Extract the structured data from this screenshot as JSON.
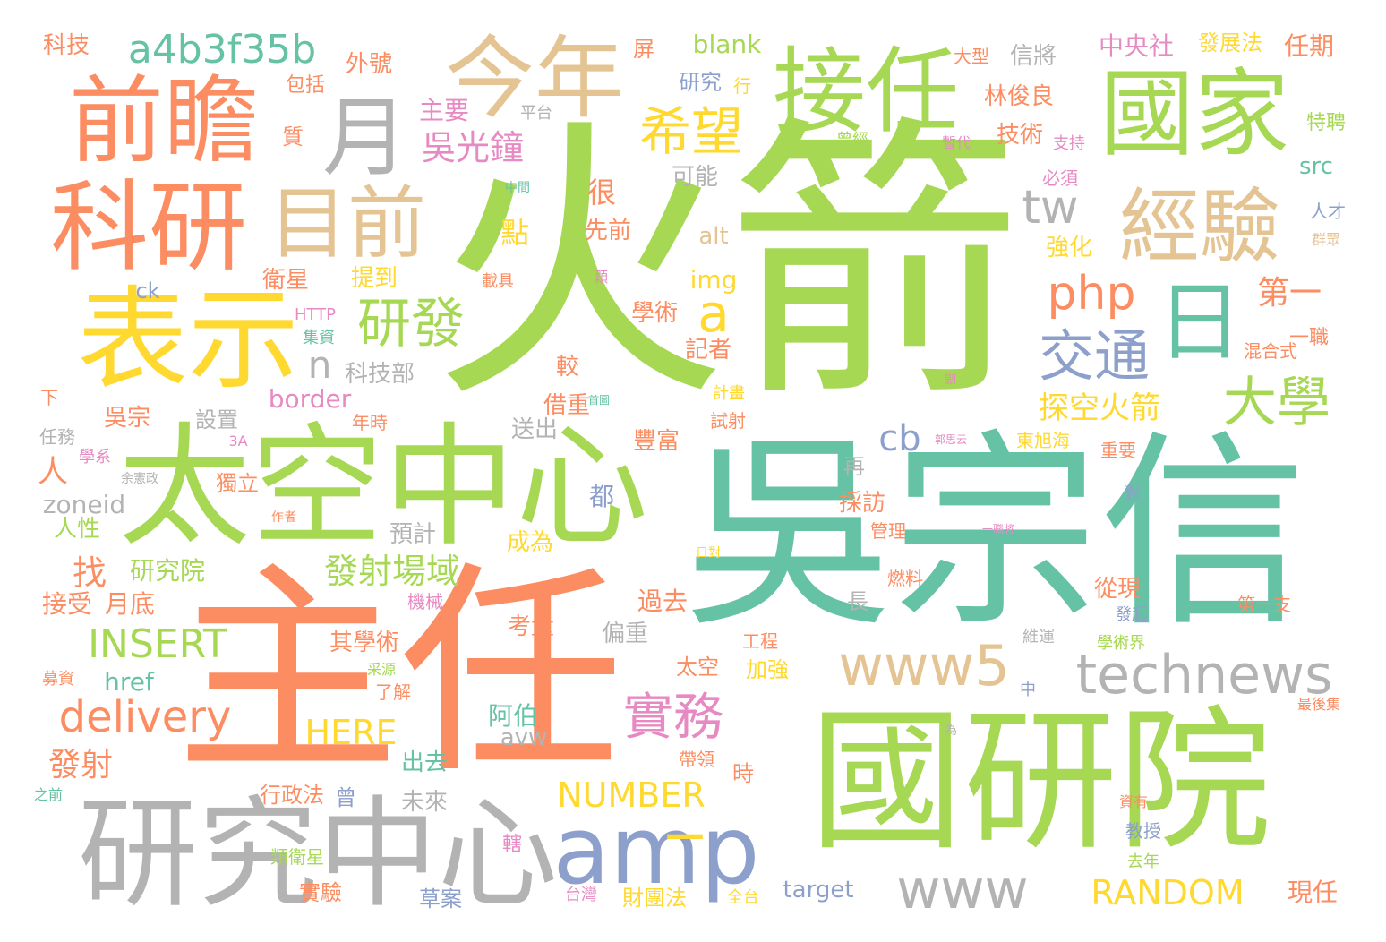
{
  "palette": {
    "green": "#a6d854",
    "teal": "#66c2a5",
    "orange": "#fc8d62",
    "tan": "#e5c494",
    "gray": "#b3b3b3",
    "blue": "#8da0cb",
    "pink": "#e78ac3",
    "yellow": "#ffd92f"
  },
  "words": [
    {
      "text": "火箭",
      "color": "green"
    },
    {
      "text": "吳宗信",
      "color": "teal"
    },
    {
      "text": "主任",
      "color": "orange"
    },
    {
      "text": "國研院",
      "color": "green"
    },
    {
      "text": "太空中心",
      "color": "green"
    },
    {
      "text": "研究中心",
      "color": "gray"
    },
    {
      "text": "前瞻",
      "color": "orange"
    },
    {
      "text": "科研",
      "color": "orange"
    },
    {
      "text": "表示",
      "color": "yellow"
    },
    {
      "text": "國家",
      "color": "green"
    },
    {
      "text": "接任",
      "color": "green"
    },
    {
      "text": "今年",
      "color": "tan"
    },
    {
      "text": "目前",
      "color": "tan"
    },
    {
      "text": "經驗",
      "color": "tan"
    },
    {
      "text": "月",
      "color": "gray"
    },
    {
      "text": "日",
      "color": "teal"
    },
    {
      "text": "amp",
      "color": "blue"
    },
    {
      "text": "technews",
      "color": "gray"
    },
    {
      "text": "www5",
      "color": "tan"
    },
    {
      "text": "www",
      "color": "gray"
    },
    {
      "text": "a4b3f35b",
      "color": "teal"
    },
    {
      "text": "希望",
      "color": "yellow"
    },
    {
      "text": "研發",
      "color": "green"
    },
    {
      "text": "交通",
      "color": "blue"
    },
    {
      "text": "大學",
      "color": "green"
    },
    {
      "text": "tw",
      "color": "gray"
    },
    {
      "text": "php",
      "color": "orange"
    },
    {
      "text": "a",
      "color": "yellow"
    },
    {
      "text": "n",
      "color": "gray"
    },
    {
      "text": "吳光鐘",
      "color": "pink"
    },
    {
      "text": "實務",
      "color": "pink"
    },
    {
      "text": "delivery",
      "color": "orange"
    },
    {
      "text": "INSERT",
      "color": "green"
    },
    {
      "text": "發射場域",
      "color": "green"
    },
    {
      "text": "探空火箭",
      "color": "yellow"
    },
    {
      "text": "cb",
      "color": "blue"
    },
    {
      "text": "RANDOM",
      "color": "yellow"
    },
    {
      "text": "NUMBER",
      "color": "yellow"
    },
    {
      "text": "HERE",
      "color": "yellow"
    },
    {
      "text": "_",
      "color": "yellow"
    },
    {
      "text": "第一",
      "color": "orange"
    },
    {
      "text": "找",
      "color": "orange"
    },
    {
      "text": "發射",
      "color": "orange"
    },
    {
      "text": "很",
      "color": "orange"
    },
    {
      "text": "點",
      "color": "yellow"
    },
    {
      "text": "人",
      "color": "orange"
    },
    {
      "text": "zoneid",
      "color": "gray"
    },
    {
      "text": "href",
      "color": "teal"
    },
    {
      "text": "border",
      "color": "pink"
    },
    {
      "text": "img",
      "color": "yellow"
    },
    {
      "text": "alt",
      "color": "tan"
    },
    {
      "text": "blank",
      "color": "green"
    },
    {
      "text": "src",
      "color": "teal"
    },
    {
      "text": "target",
      "color": "blue"
    },
    {
      "text": "avw",
      "color": "gray"
    },
    {
      "text": "ck",
      "color": "blue"
    },
    {
      "text": "HTTP",
      "color": "pink"
    },
    {
      "text": "科技",
      "color": "orange"
    },
    {
      "text": "外號",
      "color": "orange"
    },
    {
      "text": "包括",
      "color": "orange"
    },
    {
      "text": "質",
      "color": "orange"
    },
    {
      "text": "主要",
      "color": "pink"
    },
    {
      "text": "屏",
      "color": "orange"
    },
    {
      "text": "研究",
      "color": "blue"
    },
    {
      "text": "行",
      "color": "yellow"
    },
    {
      "text": "平台",
      "color": "gray"
    },
    {
      "text": "大型",
      "color": "orange"
    },
    {
      "text": "信將",
      "color": "gray"
    },
    {
      "text": "林俊良",
      "color": "orange"
    },
    {
      "text": "技術",
      "color": "orange"
    },
    {
      "text": "中央社",
      "color": "pink"
    },
    {
      "text": "發展法",
      "color": "yellow"
    },
    {
      "text": "任期",
      "color": "orange"
    },
    {
      "text": "特聘",
      "color": "green"
    },
    {
      "text": "曾經",
      "color": "green"
    },
    {
      "text": "暫代",
      "color": "pink"
    },
    {
      "text": "支持",
      "color": "pink"
    },
    {
      "text": "必須",
      "color": "pink"
    },
    {
      "text": "可能",
      "color": "gray"
    },
    {
      "text": "中間",
      "color": "teal"
    },
    {
      "text": "人才",
      "color": "blue"
    },
    {
      "text": "群眾",
      "color": "tan"
    },
    {
      "text": "強化",
      "color": "yellow"
    },
    {
      "text": "先前",
      "color": "orange"
    },
    {
      "text": "載具",
      "color": "orange"
    },
    {
      "text": "顆",
      "color": "pink"
    },
    {
      "text": "提到",
      "color": "yellow"
    },
    {
      "text": "衛星",
      "color": "orange"
    },
    {
      "text": "學術",
      "color": "orange"
    },
    {
      "text": "記者",
      "color": "orange"
    },
    {
      "text": "集資",
      "color": "teal"
    },
    {
      "text": "一職",
      "color": "orange"
    },
    {
      "text": "混合式",
      "color": "orange"
    },
    {
      "text": "科技部",
      "color": "gray"
    },
    {
      "text": "較",
      "color": "orange"
    },
    {
      "text": "副",
      "color": "pink"
    },
    {
      "text": "借重",
      "color": "orange"
    },
    {
      "text": "首圖",
      "color": "teal"
    },
    {
      "text": "計畫",
      "color": "yellow"
    },
    {
      "text": "吳宗",
      "color": "orange"
    },
    {
      "text": "設置",
      "color": "gray"
    },
    {
      "text": "年時",
      "color": "orange"
    },
    {
      "text": "試射",
      "color": "orange"
    },
    {
      "text": "送出",
      "color": "gray"
    },
    {
      "text": "豐富",
      "color": "orange"
    },
    {
      "text": "任務",
      "color": "gray"
    },
    {
      "text": "3A",
      "color": "pink"
    },
    {
      "text": "學系",
      "color": "pink"
    },
    {
      "text": "再",
      "color": "gray"
    },
    {
      "text": "郭思云",
      "color": "pink"
    },
    {
      "text": "東旭海",
      "color": "yellow"
    },
    {
      "text": "重要",
      "color": "orange"
    },
    {
      "text": "余憲政",
      "color": "gray"
    },
    {
      "text": "獨立",
      "color": "orange"
    },
    {
      "text": "都",
      "color": "blue"
    },
    {
      "text": "採訪",
      "color": "orange"
    },
    {
      "text": "對",
      "color": "blue"
    },
    {
      "text": "作者",
      "color": "orange"
    },
    {
      "text": "人性",
      "color": "green"
    },
    {
      "text": "預計",
      "color": "gray"
    },
    {
      "text": "管理",
      "color": "orange"
    },
    {
      "text": "一職將",
      "color": "pink"
    },
    {
      "text": "成為",
      "color": "yellow"
    },
    {
      "text": "研究院",
      "color": "green"
    },
    {
      "text": "日對",
      "color": "yellow"
    },
    {
      "text": "接受",
      "color": "orange"
    },
    {
      "text": "月底",
      "color": "orange"
    },
    {
      "text": "機械",
      "color": "pink"
    },
    {
      "text": "燃料",
      "color": "orange"
    },
    {
      "text": "從現",
      "color": "orange"
    },
    {
      "text": "過去",
      "color": "orange"
    },
    {
      "text": "長",
      "color": "gray"
    },
    {
      "text": "第一支",
      "color": "orange"
    },
    {
      "text": "發起",
      "color": "blue"
    },
    {
      "text": "考量",
      "color": "orange"
    },
    {
      "text": "偏重",
      "color": "gray"
    },
    {
      "text": "工程",
      "color": "orange"
    },
    {
      "text": "維運",
      "color": "gray"
    },
    {
      "text": "學術界",
      "color": "green"
    },
    {
      "text": "其學術",
      "color": "orange"
    },
    {
      "text": "太空",
      "color": "orange"
    },
    {
      "text": "加強",
      "color": "yellow"
    },
    {
      "text": "募資",
      "color": "orange"
    },
    {
      "text": "采源",
      "color": "green"
    },
    {
      "text": "了解",
      "color": "orange"
    },
    {
      "text": "中",
      "color": "blue"
    },
    {
      "text": "最後集",
      "color": "orange"
    },
    {
      "text": "阿伯",
      "color": "teal"
    },
    {
      "text": "為",
      "color": "gray"
    },
    {
      "text": "出去",
      "color": "teal"
    },
    {
      "text": "帶領",
      "color": "orange"
    },
    {
      "text": "時",
      "color": "orange"
    },
    {
      "text": "之前",
      "color": "teal"
    },
    {
      "text": "行政法",
      "color": "orange"
    },
    {
      "text": "曾",
      "color": "blue"
    },
    {
      "text": "未來",
      "color": "gray"
    },
    {
      "text": "資有",
      "color": "orange"
    },
    {
      "text": "教授",
      "color": "blue"
    },
    {
      "text": "轄",
      "color": "pink"
    },
    {
      "text": "類衛星",
      "color": "green"
    },
    {
      "text": "去年",
      "color": "green"
    },
    {
      "text": "實驗",
      "color": "orange"
    },
    {
      "text": "草案",
      "color": "blue"
    },
    {
      "text": "台灣",
      "color": "pink"
    },
    {
      "text": "財團法",
      "color": "yellow"
    },
    {
      "text": "全台",
      "color": "yellow"
    },
    {
      "text": "現任",
      "color": "orange"
    },
    {
      "text": "下",
      "color": "orange"
    }
  ]
}
